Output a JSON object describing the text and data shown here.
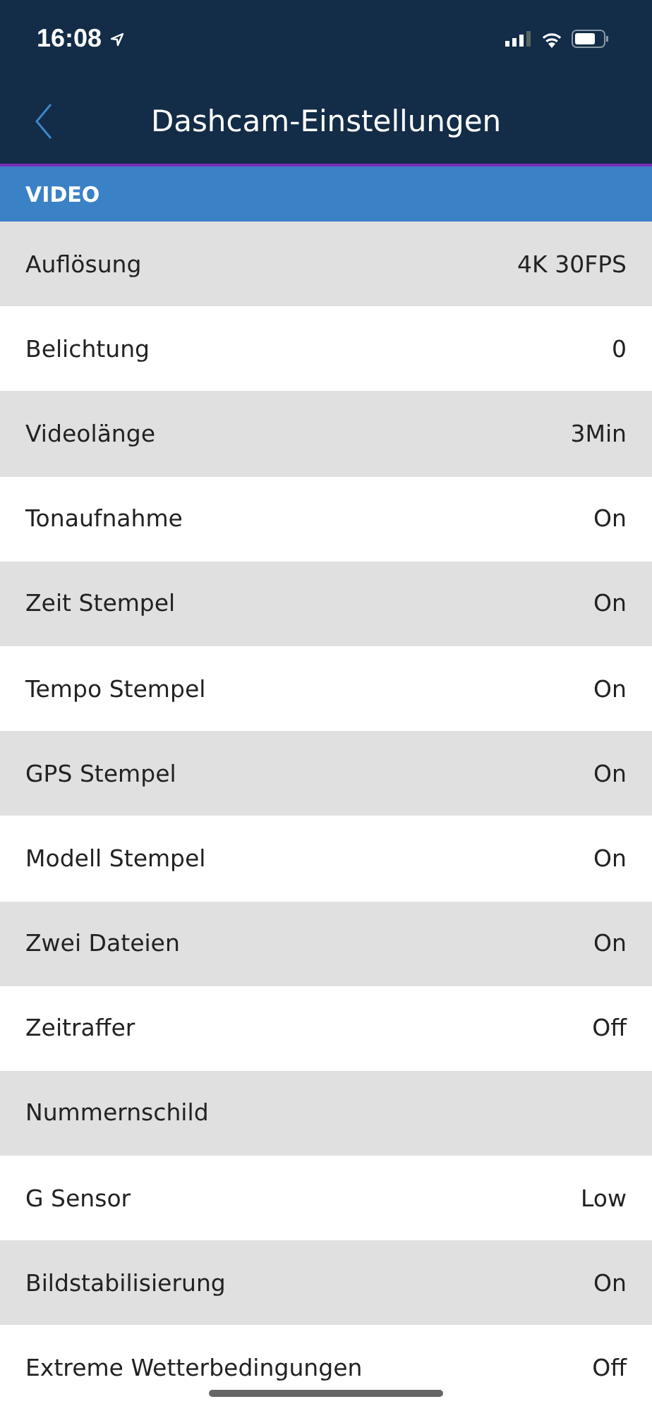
{
  "status_bar": {
    "time": "16:08"
  },
  "nav": {
    "title": "Dashcam-Einstellungen"
  },
  "section": {
    "title": "VIDEO"
  },
  "rows": [
    {
      "label": "Auflösung",
      "value": "4K 30FPS"
    },
    {
      "label": "Belichtung",
      "value": "0"
    },
    {
      "label": "Videolänge",
      "value": "3Min"
    },
    {
      "label": "Tonaufnahme",
      "value": "On"
    },
    {
      "label": "Zeit Stempel",
      "value": "On"
    },
    {
      "label": "Tempo Stempel",
      "value": "On"
    },
    {
      "label": "GPS Stempel",
      "value": "On"
    },
    {
      "label": "Modell Stempel",
      "value": "On"
    },
    {
      "label": "Zwei Dateien",
      "value": "On"
    },
    {
      "label": "Zeitraffer",
      "value": "Off"
    },
    {
      "label": "Nummernschild"
    },
    {
      "label": "G Sensor",
      "value": "Low"
    },
    {
      "label": "Bildstabilisierung",
      "value": "On"
    },
    {
      "label": "Extreme Wetterbedingungen",
      "value": "Off"
    }
  ]
}
